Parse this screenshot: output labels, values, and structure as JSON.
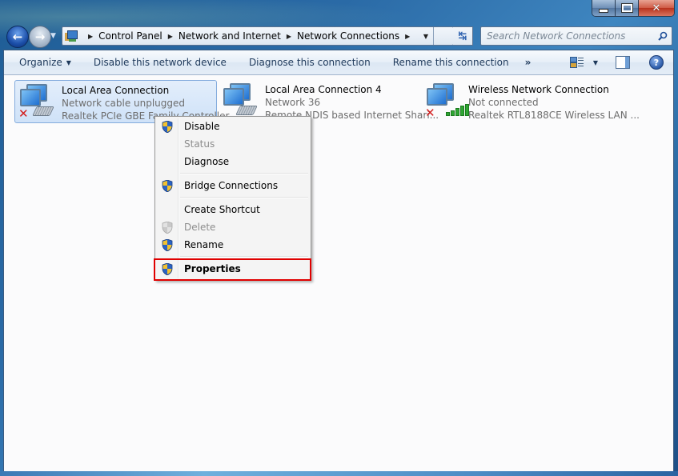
{
  "window": {
    "caption_buttons": [
      {
        "name": "minimize",
        "icon": "minimize-icon"
      },
      {
        "name": "maximize",
        "icon": "maximize-icon"
      },
      {
        "name": "close",
        "icon": "close-icon"
      }
    ],
    "close_glyph": "✕"
  },
  "nav": {
    "back_glyph": "←",
    "forward_glyph": "→",
    "history_glyph": "▼"
  },
  "address": {
    "crumbs": [
      "Control Panel",
      "Network and Internet",
      "Network Connections"
    ],
    "crumb_separator": "▶",
    "dropdown_glyph": "▼",
    "refresh_glyph": "↹"
  },
  "search": {
    "placeholder": "Search Network Connections"
  },
  "toolbar": {
    "organize": "Organize",
    "dropdown_glyph": "▼",
    "items": [
      "Disable this network device",
      "Diagnose this connection",
      "Rename this connection"
    ],
    "more": "»",
    "view_dropdown_glyph": "▼",
    "help_glyph": "?"
  },
  "connections": [
    {
      "name": "Local Area Connection",
      "status": "Network cable unplugged",
      "device": "Realtek PCIe GBE Family Controller",
      "selected": true,
      "disconnected": true,
      "type": "wired"
    },
    {
      "name": "Local Area Connection 4",
      "status": "Network  36",
      "device": "Remote NDIS based Internet Shari...",
      "selected": false,
      "disconnected": false,
      "type": "wired"
    },
    {
      "name": "Wireless Network Connection",
      "status": "Not connected",
      "device": "Realtek RTL8188CE Wireless LAN ...",
      "selected": false,
      "disconnected": true,
      "type": "wireless"
    }
  ],
  "context_menu": {
    "items": [
      {
        "label": "Disable",
        "shield": true,
        "enabled": true
      },
      {
        "label": "Status",
        "shield": false,
        "enabled": false
      },
      {
        "label": "Diagnose",
        "shield": false,
        "enabled": true
      },
      {
        "label": "Bridge Connections",
        "shield": true,
        "enabled": true
      },
      {
        "label": "Create Shortcut",
        "shield": false,
        "enabled": true
      },
      {
        "label": "Delete",
        "shield": true,
        "enabled": false
      },
      {
        "label": "Rename",
        "shield": true,
        "enabled": true
      },
      {
        "label": "Properties",
        "shield": true,
        "enabled": true,
        "default": true,
        "highlighted": true
      }
    ],
    "x_glyph": "✕"
  },
  "colors": {
    "highlight_border": "#e00000",
    "selection_bg": "#cfe2f8",
    "disabled_text": "#8d8d8d"
  }
}
